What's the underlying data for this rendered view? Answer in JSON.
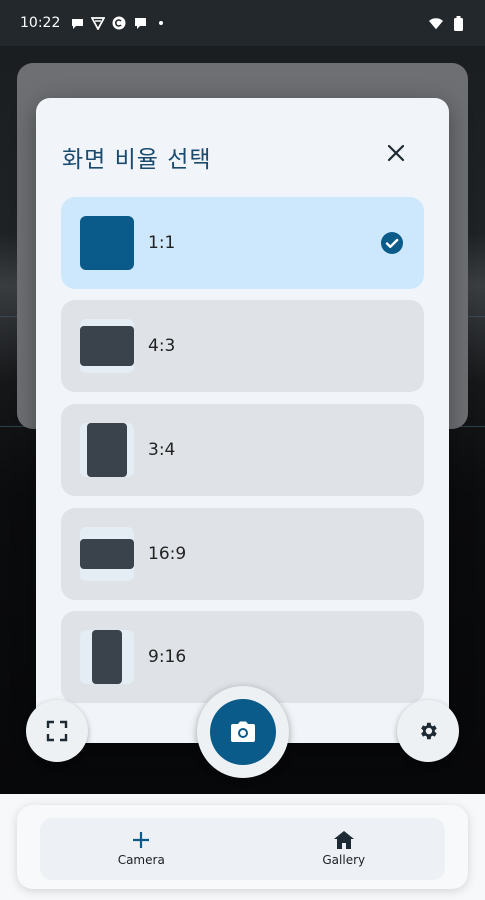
{
  "status_bar": {
    "time": "10:22",
    "icons": [
      "chat-bubble-icon",
      "vpn-icon",
      "circle-c-icon",
      "message-icon",
      "dot-icon"
    ],
    "right_icons": [
      "wifi-icon",
      "battery-icon"
    ]
  },
  "dialog": {
    "title": "화면 비율 선택",
    "close_icon": "close-icon",
    "options": [
      {
        "label": "1:1",
        "selected": true
      },
      {
        "label": "4:3",
        "selected": false
      },
      {
        "label": "3:4",
        "selected": false
      },
      {
        "label": "16:9",
        "selected": false
      },
      {
        "label": "9:16",
        "selected": false
      }
    ]
  },
  "controls": {
    "left_icon": "fullscreen-icon",
    "shutter_icon": "camera-icon",
    "right_icon": "settings-icon"
  },
  "nav": {
    "items": [
      {
        "label": "Camera",
        "icon": "plus-icon"
      },
      {
        "label": "Gallery",
        "icon": "home-icon"
      }
    ]
  },
  "colors": {
    "accent": "#0b5b8a",
    "selected_bg": "#cde8fc",
    "title": "#1a4a6e"
  }
}
